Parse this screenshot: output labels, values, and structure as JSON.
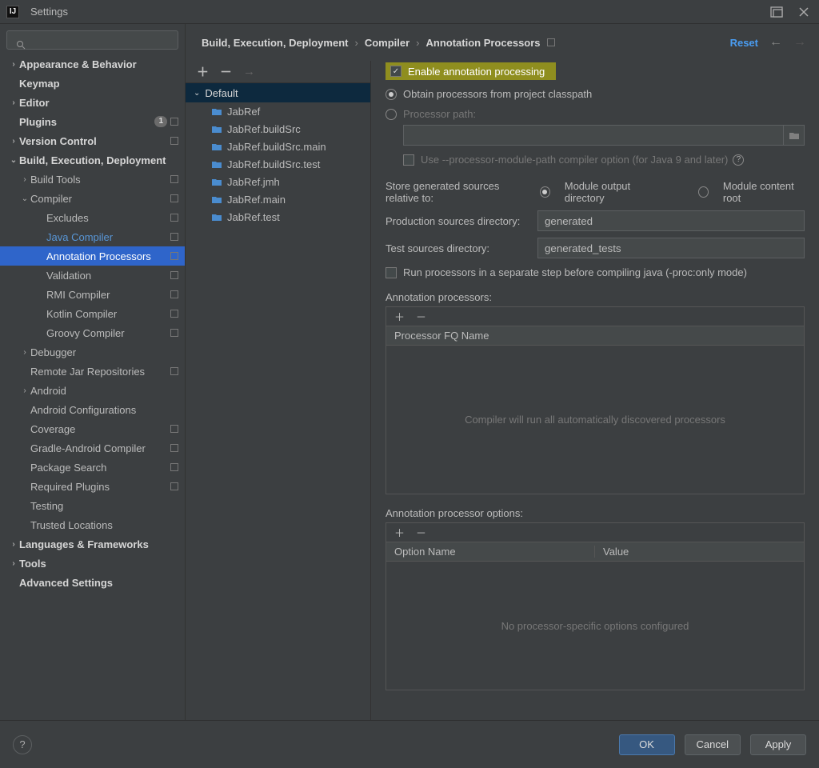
{
  "window": {
    "title": "Settings"
  },
  "search": {
    "placeholder": ""
  },
  "sidebar": [
    {
      "label": "Appearance & Behavior",
      "level": 0,
      "arrow": ">",
      "bold": true
    },
    {
      "label": "Keymap",
      "level": 0,
      "bold": true
    },
    {
      "label": "Editor",
      "level": 0,
      "arrow": ">",
      "bold": true
    },
    {
      "label": "Plugins",
      "level": 0,
      "bold": true,
      "badge": "1",
      "cube": true
    },
    {
      "label": "Version Control",
      "level": 0,
      "arrow": ">",
      "bold": true,
      "cube": true
    },
    {
      "label": "Build, Execution, Deployment",
      "level": 0,
      "arrow": "v",
      "bold": true
    },
    {
      "label": "Build Tools",
      "level": 1,
      "arrow": ">",
      "cube": true
    },
    {
      "label": "Compiler",
      "level": 1,
      "arrow": "v",
      "cube": true
    },
    {
      "label": "Excludes",
      "level": 2,
      "cube": true
    },
    {
      "label": "Java Compiler",
      "level": 2,
      "link": true,
      "cube": true
    },
    {
      "label": "Annotation Processors",
      "level": 2,
      "selected": true,
      "cube": true
    },
    {
      "label": "Validation",
      "level": 2,
      "cube": true
    },
    {
      "label": "RMI Compiler",
      "level": 2,
      "cube": true
    },
    {
      "label": "Kotlin Compiler",
      "level": 2,
      "cube": true
    },
    {
      "label": "Groovy Compiler",
      "level": 2,
      "cube": true
    },
    {
      "label": "Debugger",
      "level": 1,
      "arrow": ">"
    },
    {
      "label": "Remote Jar Repositories",
      "level": 1,
      "cube": true
    },
    {
      "label": "Android",
      "level": 1,
      "arrow": ">"
    },
    {
      "label": "Android Configurations",
      "level": 1
    },
    {
      "label": "Coverage",
      "level": 1,
      "cube": true
    },
    {
      "label": "Gradle-Android Compiler",
      "level": 1,
      "cube": true
    },
    {
      "label": "Package Search",
      "level": 1,
      "cube": true
    },
    {
      "label": "Required Plugins",
      "level": 1,
      "cube": true
    },
    {
      "label": "Testing",
      "level": 1
    },
    {
      "label": "Trusted Locations",
      "level": 1
    },
    {
      "label": "Languages & Frameworks",
      "level": 0,
      "arrow": ">",
      "bold": true
    },
    {
      "label": "Tools",
      "level": 0,
      "arrow": ">",
      "bold": true
    },
    {
      "label": "Advanced Settings",
      "level": 0,
      "bold": true
    }
  ],
  "breadcrumb": {
    "a": "Build, Execution, Deployment",
    "b": "Compiler",
    "c": "Annotation Processors",
    "reset": "Reset"
  },
  "profiles": {
    "root": "Default",
    "modules": [
      "JabRef",
      "JabRef.buildSrc",
      "JabRef.buildSrc.main",
      "JabRef.buildSrc.test",
      "JabRef.jmh",
      "JabRef.main",
      "JabRef.test"
    ]
  },
  "opts": {
    "enable": "Enable annotation processing",
    "obtain": "Obtain processors from project classpath",
    "procpath": "Processor path:",
    "modpath": "Use --processor-module-path compiler option (for Java 9 and later)",
    "storeRel": "Store generated sources relative to:",
    "modOut": "Module output directory",
    "modContent": "Module content root",
    "prodLabel": "Production sources directory:",
    "prodVal": "generated",
    "testLabel": "Test sources directory:",
    "testVal": "generated_tests",
    "separate": "Run processors in a separate step before compiling java (-proc:only mode)",
    "apTitle": "Annotation processors:",
    "apHeader": "Processor FQ Name",
    "apEmpty": "Compiler will run all automatically discovered processors",
    "optTitle": "Annotation processor options:",
    "optCol1": "Option Name",
    "optCol2": "Value",
    "optEmpty": "No processor-specific options configured"
  },
  "footer": {
    "ok": "OK",
    "cancel": "Cancel",
    "apply": "Apply",
    "help": "?"
  }
}
